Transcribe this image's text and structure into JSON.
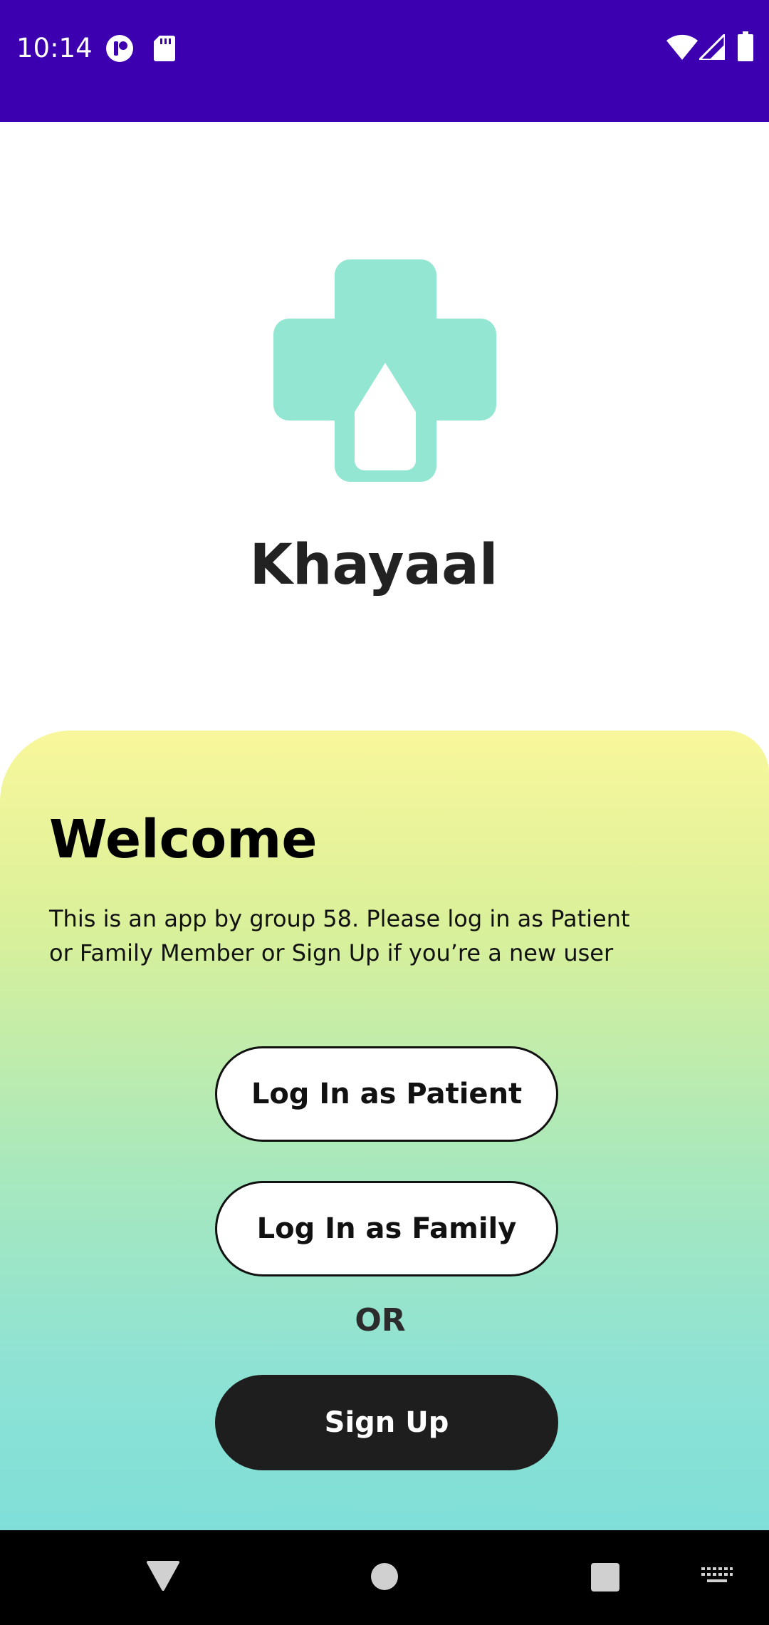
{
  "status_bar": {
    "time": "10:14",
    "icons": [
      "notification-app-icon",
      "sd-card-icon",
      "wifi-icon",
      "signal-icon",
      "battery-icon"
    ],
    "background": "#3c00b0"
  },
  "app": {
    "name": "Khayaal",
    "logo_icon": "medical-cross-drop-icon",
    "logo_color": "#93e6d2"
  },
  "welcome": {
    "title": "Welcome",
    "text_line1": "This is an app by group 58. Please log in as Patient",
    "text_line2": "or Family Member or Sign Up if you’re a new user"
  },
  "actions": {
    "login_patient_label": "Log In as Patient",
    "login_family_label": "Log In as Family",
    "or_label": "OR",
    "signup_label": "Sign Up"
  },
  "nav_bar": {
    "buttons": [
      "back-icon",
      "home-icon",
      "recents-icon",
      "keyboard-icon"
    ]
  }
}
